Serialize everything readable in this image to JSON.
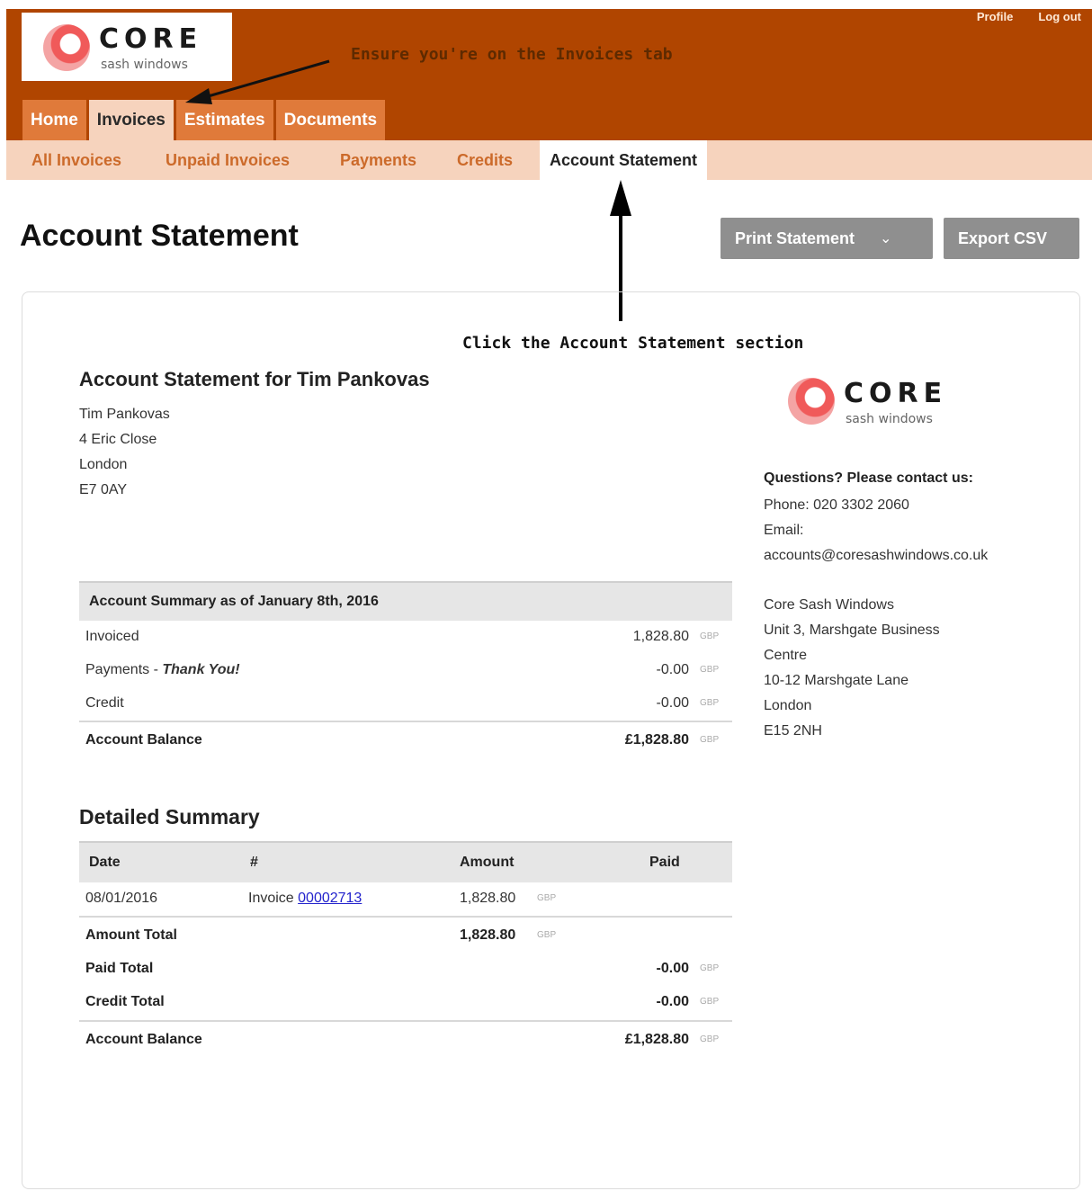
{
  "brand": {
    "word": "CORE",
    "sub": "sash windows"
  },
  "top_links": [
    "Profile",
    "Log out"
  ],
  "annotations": {
    "header_note": "Ensure you're on the Invoices tab",
    "card_note": "Click the Account Statement section"
  },
  "main_tabs": [
    {
      "label": "Home",
      "active": false
    },
    {
      "label": "Invoices",
      "active": true
    },
    {
      "label": "Estimates",
      "active": false
    },
    {
      "label": "Documents",
      "active": false
    }
  ],
  "sub_tabs": [
    {
      "label": "All Invoices",
      "active": false
    },
    {
      "label": "Unpaid Invoices",
      "active": false
    },
    {
      "label": "Payments",
      "active": false
    },
    {
      "label": "Credits",
      "active": false
    },
    {
      "label": "Account Statement",
      "active": true
    }
  ],
  "page": {
    "title": "Account Statement",
    "print_button": "Print Statement",
    "export_button": "Export CSV"
  },
  "statement": {
    "heading": "Account Statement for Tim Pankovas",
    "address": [
      "Tim Pankovas",
      "4 Eric Close",
      "London",
      "E7 0AY"
    ]
  },
  "contact": {
    "heading": "Questions? Please contact us:",
    "phone": "Phone: 020 3302 2060",
    "email_label": "Email:",
    "email": "accounts@coresashwindows.co.uk",
    "company_address": [
      "Core Sash Windows",
      "Unit 3, Marshgate Business",
      "Centre",
      "10-12 Marshgate Lane",
      "London",
      "E15 2NH"
    ]
  },
  "summary": {
    "heading": "Account Summary as of January 8th, 2016",
    "currency": "GBP",
    "rows": [
      {
        "label": "Invoiced",
        "value": "1,828.80"
      },
      {
        "label": "Payments - ",
        "emphasis": "Thank You!",
        "value": "-0.00"
      },
      {
        "label": "Credit",
        "value": "-0.00"
      }
    ],
    "balance": {
      "label": "Account Balance",
      "value": "£1,828.80"
    }
  },
  "detail": {
    "heading": "Detailed Summary",
    "columns": [
      "Date",
      "#",
      "Amount",
      "Paid"
    ],
    "rows": [
      {
        "date": "08/01/2016",
        "ref_prefix": "Invoice ",
        "ref_link": "00002713",
        "amount": "1,828.80"
      }
    ],
    "amount_total": {
      "label": "Amount Total",
      "value": "1,828.80"
    },
    "paid_total": {
      "label": "Paid Total",
      "value": "-0.00"
    },
    "credit_total": {
      "label": "Credit Total",
      "value": "-0.00"
    },
    "balance": {
      "label": "Account Balance",
      "value": "£1,828.80"
    }
  }
}
